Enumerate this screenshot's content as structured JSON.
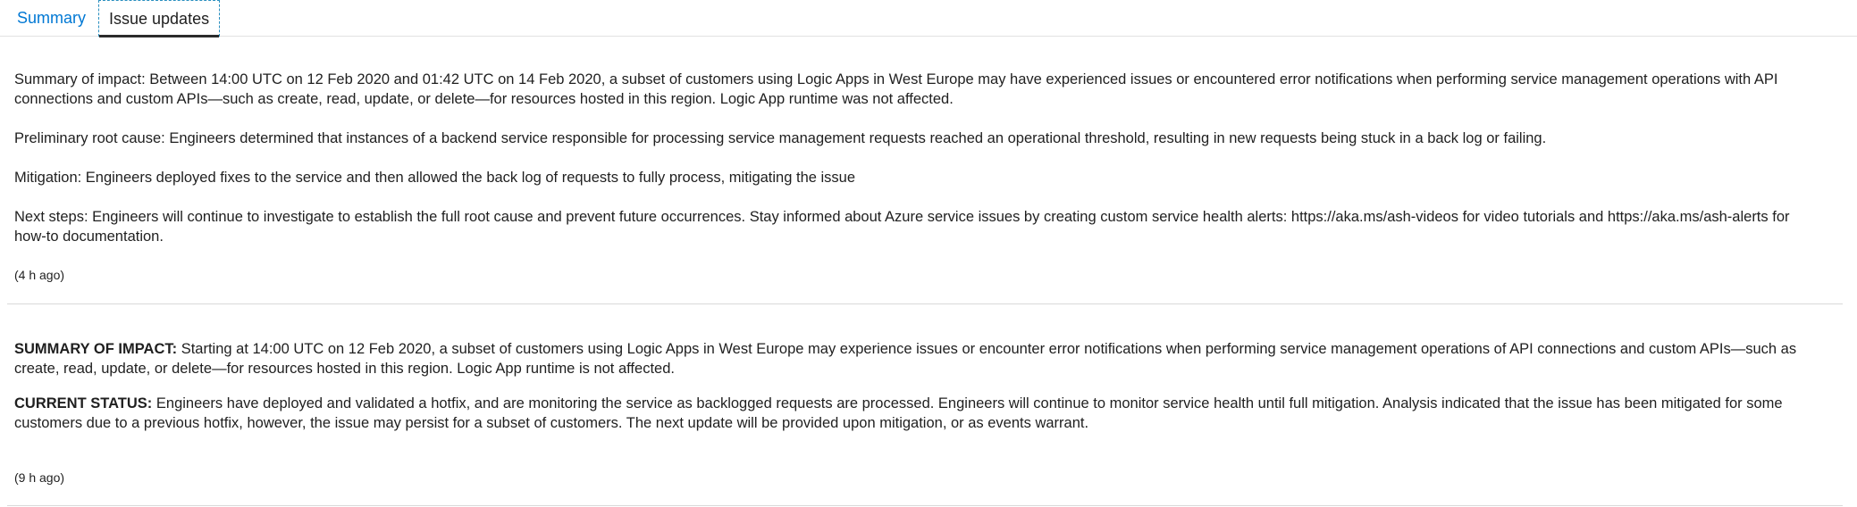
{
  "tabs": [
    {
      "label": "Summary"
    },
    {
      "label": "Issue updates"
    }
  ],
  "updates": [
    {
      "paragraphs": [
        "Summary of impact: Between 14:00 UTC on 12 Feb 2020 and 01:42 UTC on 14 Feb 2020, a subset of customers using Logic Apps in West Europe may have experienced issues or encountered error notifications when performing service management operations with API connections and custom APIs—such as create, read, update, or delete—for resources hosted in this region. Logic App runtime was not affected.",
        "Preliminary root cause: Engineers determined that instances of a backend service responsible for processing service management requests reached an operational threshold, resulting in new requests being stuck in a back log or failing.",
        "Mitigation: Engineers deployed fixes to the service and then allowed the back log of requests to fully process, mitigating the issue",
        "Next steps: Engineers will continue to investigate to establish the full root cause and prevent future occurrences. Stay informed about Azure service issues by creating custom service health alerts: https://aka.ms/ash-videos for video tutorials and https://aka.ms/ash-alerts for how-to documentation."
      ],
      "timestamp": "(4 h ago)"
    },
    {
      "impact_label": "SUMMARY OF IMPACT:",
      "impact_text": " Starting at 14:00 UTC on 12 Feb 2020, a subset of customers using Logic Apps in West Europe may experience issues or encounter error notifications when performing service management operations of API connections and custom APIs—such as create, read, update, or delete—for resources hosted in this region. Logic App runtime is not affected.",
      "status_label": "CURRENT STATUS:",
      "status_text": " Engineers have deployed and validated a hotfix, and are monitoring the service as backlogged requests are processed. Engineers will continue to monitor service health until full mitigation. Analysis indicated that the issue has been mitigated for some customers due to a previous hotfix, however, the issue may persist for a subset of customers. The next update will be provided upon mitigation, or as events warrant.",
      "timestamp": "(9 h ago)"
    }
  ]
}
